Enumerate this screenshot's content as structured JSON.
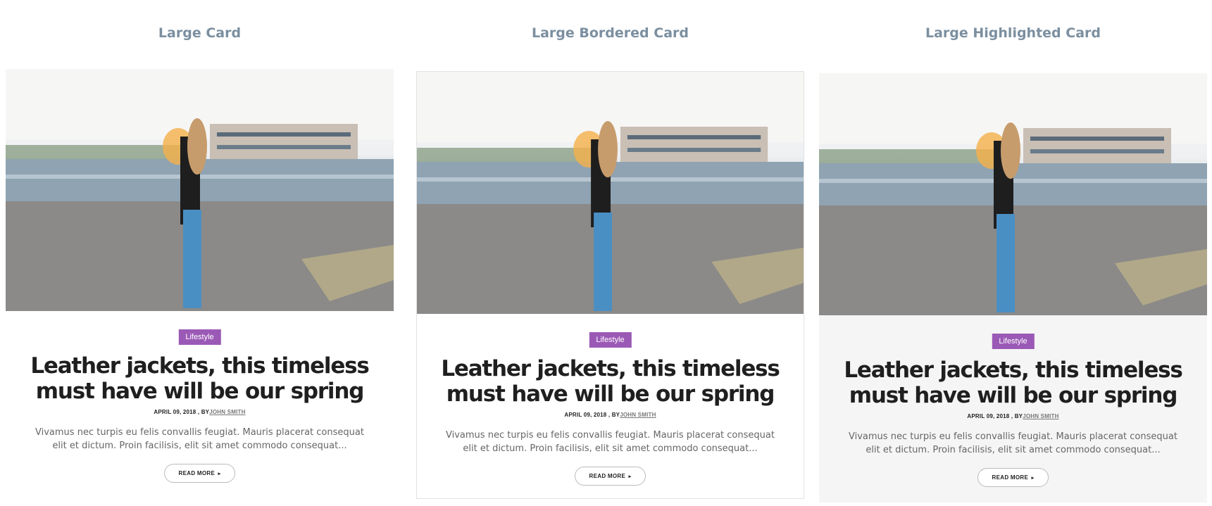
{
  "columns": [
    {
      "heading": "Large Card",
      "card": {
        "tag": "Lifestyle",
        "title": "Leather jackets, this timeless must have will be our spring",
        "date": "APRIL 09, 2018 , BY",
        "author": "JOHN SMITH",
        "excerpt": "Vivamus nec turpis eu felis convallis feugiat. Mauris placerat consequat elit et dictum. Proin facilisis, elit sit amet commodo consequat...",
        "read_more": "READ MORE",
        "caret": "▸"
      }
    },
    {
      "heading": "Large Bordered Card",
      "card": {
        "tag": "Lifestyle",
        "title": "Leather jackets, this timeless must have will be our spring",
        "date": "APRIL 09, 2018 , BY",
        "author": "JOHN SMITH",
        "excerpt": "Vivamus nec turpis eu felis convallis feugiat. Mauris placerat consequat elit et dictum. Proin facilisis, elit sit amet commodo consequat...",
        "read_more": "READ MORE",
        "caret": "▸"
      }
    },
    {
      "heading": "Large Highlighted Card",
      "card": {
        "tag": "Lifestyle",
        "title": "Leather jackets, this timeless must have will be our spring",
        "date": "APRIL 09, 2018 , BY",
        "author": "JOHN SMITH",
        "excerpt": "Vivamus nec turpis eu felis convallis feugiat. Mauris placerat consequat elit et dictum. Proin facilisis, elit sit amet commodo consequat...",
        "read_more": "READ MORE",
        "caret": "▸"
      }
    }
  ],
  "colors": {
    "heading": "#7b8fa0",
    "tag_background": "#9b59b6",
    "title": "#1f1f1f",
    "excerpt": "#666666",
    "highlight_background": "#f5f5f5",
    "border": "#e2e2e2"
  }
}
